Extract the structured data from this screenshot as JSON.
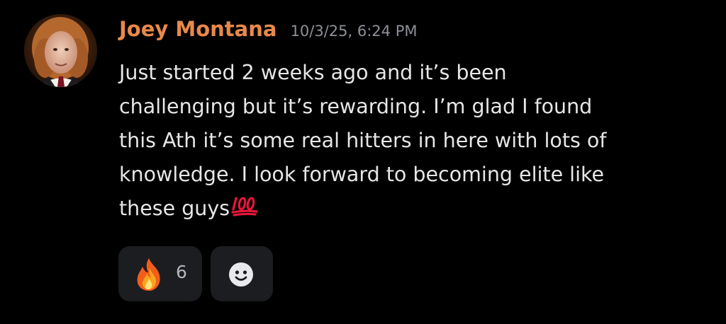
{
  "message": {
    "author": "Joey Montana",
    "timestamp": "10/3/25, 6:24 PM",
    "lines": [
      "Just started 2 weeks ago and it’s been",
      "challenging but it’s rewarding.  I’m glad I found",
      "this Ath it’s some real hitters in here with lots of",
      "knowledge. I look forward to becoming elite like",
      "these guys"
    ],
    "trailing_emoji": "hundred-points-icon",
    "author_color": "#e8894a"
  },
  "reactions": [
    {
      "icon": "fire-icon",
      "count": "6"
    },
    {
      "icon": "add-reaction-smiley-icon"
    }
  ]
}
